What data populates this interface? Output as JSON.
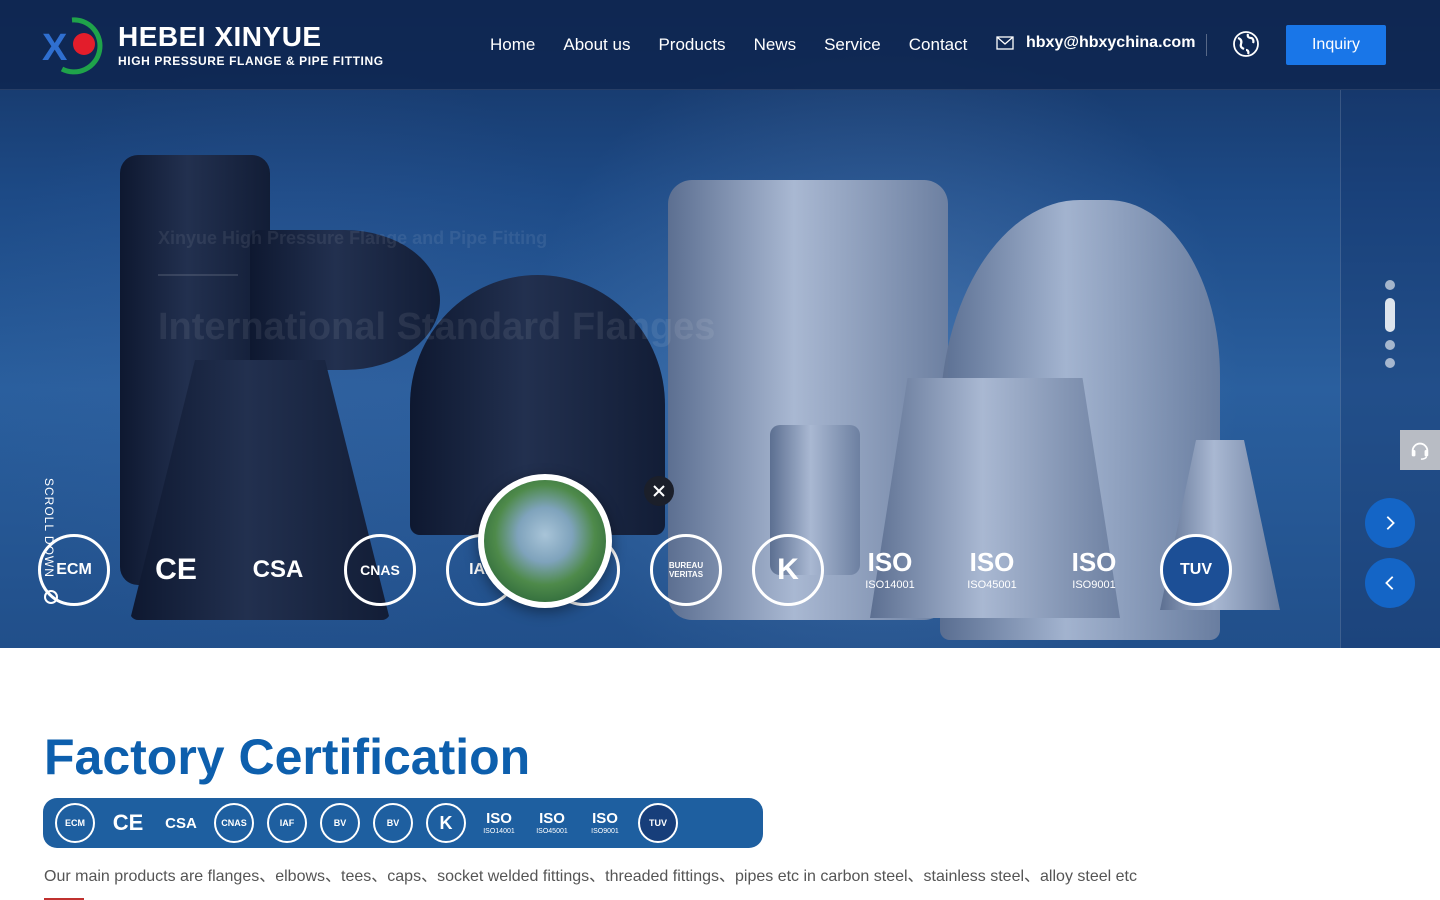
{
  "header": {
    "logo_title": "HEBEI XINYUE",
    "logo_subtitle": "HIGH PRESSURE FLANGE & PIPE FITTING",
    "nav": [
      "Home",
      "About us",
      "Products",
      "News",
      "Service",
      "Contact"
    ],
    "email": "hbxy@hbxychina.com",
    "inquiry_label": "Inquiry"
  },
  "hero": {
    "faded_subtitle": "Xinyue High Pressure Flange and Pipe Fitting",
    "faded_title": "International Standard Flanges",
    "scroll_label": "SCROLL DOWN",
    "certs": [
      {
        "label": "ECM",
        "kind": "circle"
      },
      {
        "label": "CE",
        "kind": "text"
      },
      {
        "label": "CSA",
        "kind": "text"
      },
      {
        "label": "CNAS",
        "kind": "circle"
      },
      {
        "label": "IAF",
        "kind": "circle"
      },
      {
        "label": "BUREAU VERITAS",
        "kind": "circle"
      },
      {
        "label": "BUREAU VERITAS",
        "kind": "circle"
      },
      {
        "label": "K",
        "kind": "circle"
      },
      {
        "label": "ISO",
        "sub": "ISO14001",
        "kind": "iso"
      },
      {
        "label": "ISO",
        "sub": "ISO45001",
        "kind": "iso"
      },
      {
        "label": "ISO",
        "sub": "ISO9001",
        "kind": "iso"
      },
      {
        "label": "TUV",
        "kind": "circle"
      }
    ]
  },
  "section": {
    "title": "Factory Certification",
    "strip": [
      {
        "label": "ECM",
        "kind": "circle"
      },
      {
        "label": "CE",
        "kind": "text"
      },
      {
        "label": "CSA",
        "kind": "text"
      },
      {
        "label": "CNAS",
        "kind": "circle"
      },
      {
        "label": "IAF",
        "kind": "circle"
      },
      {
        "label": "BV",
        "kind": "circle"
      },
      {
        "label": "BV",
        "kind": "circle"
      },
      {
        "label": "K",
        "kind": "circle"
      },
      {
        "label": "ISO",
        "sub": "ISO14001",
        "kind": "iso"
      },
      {
        "label": "ISO",
        "sub": "ISO45001",
        "kind": "iso"
      },
      {
        "label": "ISO",
        "sub": "ISO9001",
        "kind": "iso"
      },
      {
        "label": "TUV",
        "kind": "circle"
      }
    ],
    "description": "Our main products are flanges、elbows、tees、caps、socket welded fittings、threaded fittings、pipes etc in carbon steel、stainless steel、alloy steel etc"
  },
  "colors": {
    "accent": "#1976e8",
    "title_blue": "#0d5fad",
    "strip_blue": "#1e5fa0",
    "arrow_blue": "#1465c6"
  }
}
